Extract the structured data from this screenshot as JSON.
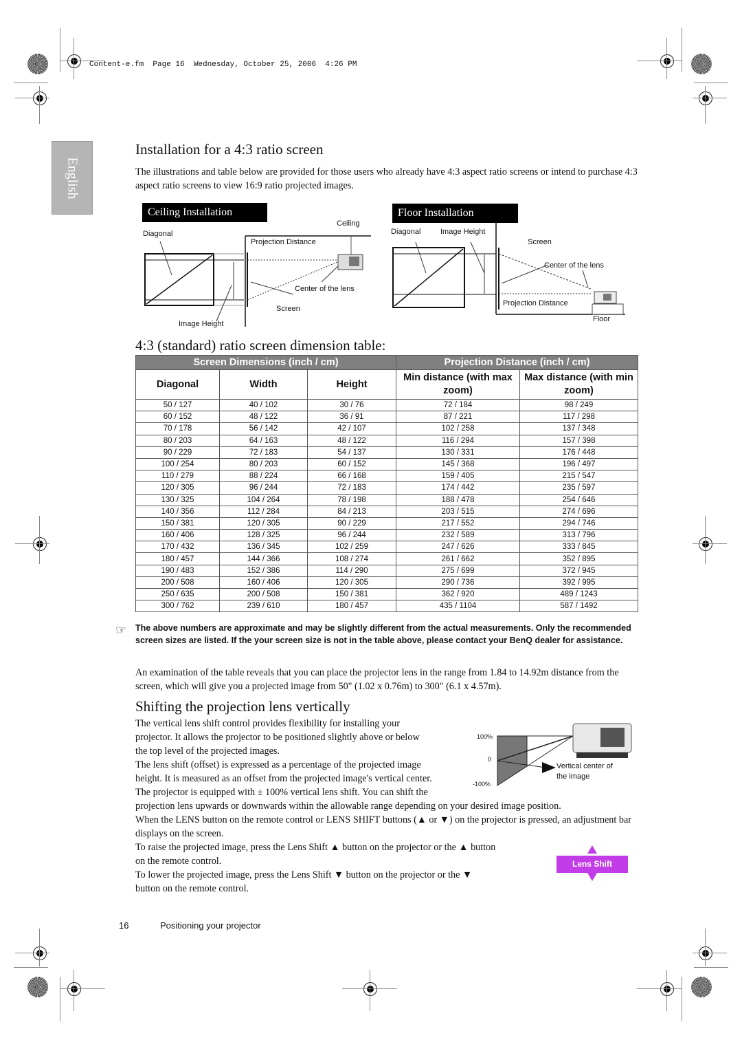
{
  "header": {
    "frame_info": "Content-e.fm  Page 16  Wednesday, October 25, 2006  4:26 PM"
  },
  "language_tab": "English",
  "section1": {
    "title": "Installation for a 4:3 ratio screen",
    "intro": "The illustrations and table below are provided for those users who already have 4:3 aspect ratio screens or intend to purchase 4:3 aspect ratio screens to view 16:9 ratio projected images."
  },
  "ceiling_diagram": {
    "label": "Ceiling Installation",
    "ceiling": "Ceiling",
    "diagonal": "Diagonal",
    "projection_distance": "Projection Distance",
    "center_of_lens": "Center of the lens",
    "screen": "Screen",
    "image_height": "Image Height"
  },
  "floor_diagram": {
    "label": "Floor Installation",
    "diagonal": "Diagonal",
    "image_height": "Image Height",
    "screen": "Screen",
    "center_of_lens": "Center of the lens",
    "projection_distance": "Projection Distance",
    "floor": "Floor"
  },
  "table_section": {
    "title": "4:3 (standard) ratio screen dimension table:",
    "group_headers": [
      "Screen Dimensions (inch / cm)",
      "Projection Distance (inch / cm)"
    ],
    "columns": [
      "Diagonal",
      "Width",
      "Height",
      "Min distance (with max zoom)",
      "Max distance (with min zoom)"
    ],
    "rows": [
      [
        "50 / 127",
        "40 / 102",
        "30 / 76",
        "72 / 184",
        "98 / 249"
      ],
      [
        "60 / 152",
        "48 / 122",
        "36 / 91",
        "87 / 221",
        "117 / 298"
      ],
      [
        "70 / 178",
        "56 / 142",
        "42 / 107",
        "102 / 258",
        "137 / 348"
      ],
      [
        "80 / 203",
        "64 / 163",
        "48 / 122",
        "116 / 294",
        "157 / 398"
      ],
      [
        "90 / 229",
        "72 / 183",
        "54 / 137",
        "130 / 331",
        "176 / 448"
      ],
      [
        "100 / 254",
        "80 / 203",
        "60 / 152",
        "145 / 368",
        "196 / 497"
      ],
      [
        "110 / 279",
        "88 / 224",
        "66 / 168",
        "159 / 405",
        "215 / 547"
      ],
      [
        "120 / 305",
        "96 / 244",
        "72 / 183",
        "174 / 442",
        "235 / 597"
      ],
      [
        "130 / 325",
        "104 / 264",
        "78 / 198",
        "188 / 478",
        "254 / 646"
      ],
      [
        "140 / 356",
        "112 / 284",
        "84 / 213",
        "203 / 515",
        "274 / 696"
      ],
      [
        "150 / 381",
        "120 / 305",
        "90 / 229",
        "217 / 552",
        "294 / 746"
      ],
      [
        "160 / 406",
        "128 / 325",
        "96 / 244",
        "232 / 589",
        "313 / 796"
      ],
      [
        "170 / 432",
        "136 / 345",
        "102 / 259",
        "247 / 626",
        "333 / 845"
      ],
      [
        "180 / 457",
        "144 / 366",
        "108 / 274",
        "261 / 662",
        "352 / 895"
      ],
      [
        "190 / 483",
        "152 / 386",
        "114 / 290",
        "275 / 699",
        "372 / 945"
      ],
      [
        "200 / 508",
        "160 / 406",
        "120 / 305",
        "290 / 736",
        "392 / 995"
      ],
      [
        "250 / 635",
        "200 / 508",
        "150 / 381",
        "362 / 920",
        "489 / 1243"
      ],
      [
        "300 / 762",
        "239 / 610",
        "180 / 457",
        "435 / 1104",
        "587 / 1492"
      ]
    ],
    "header_color": "#808080"
  },
  "note": "The above numbers are approximate and may be slightly different from the actual measurements. Only the recommended screen sizes are listed. If the your screen size is not in the table above, please contact your BenQ dealer for assistance.",
  "examination": "An examination of the table reveals that you can place the projector lens in the range from 1.84 to 14.92m distance from the screen, which will give you a projected image from 50\" (1.02 x 0.76m) to 300\" (6.1 x 4.57m).",
  "section2": {
    "title": "Shifting the projection lens vertically",
    "para1_lines": [
      "The vertical lens shift control provides flexibility for installing your",
      "projector. It allows the projector to be positioned slightly above or below",
      "the top level of the projected images.",
      "The lens shift (offset) is expressed as a percentage of the projected image",
      "height. It is measured as an offset from the projected image's vertical center.",
      "The projector is equipped with ± 100% vertical lens shift. You can shift the"
    ],
    "para1_cont": "projection lens upwards or downwards within the allowable range depending on your desired image position.",
    "para2": {
      "a": "When the ",
      "b": "LENS",
      "c": " button on the remote control or ",
      "d": "LENS SHIFT",
      "e": " buttons (▲ or ▼) on the projector is pressed, an adjustment bar displays on the screen."
    },
    "raise": {
      "a": "To raise the projected image, press the ",
      "b": "Lens Shift",
      "c": " ▲ button on the projector or the ▲ button",
      "d": "on the remote control."
    },
    "lower": {
      "a": "To lower the projected image, press the ",
      "b": "Lens Shift",
      "c": " ▼ button on the projector or the ▼",
      "d": "button on the remote control."
    },
    "shift_diagram": {
      "top": "100%",
      "center": "0",
      "bottom": "-100%",
      "caption_line1": "Vertical center of",
      "caption_line2": "the image"
    },
    "lens_shift_button": {
      "label": "Lens Shift",
      "color": "#c23de8"
    }
  },
  "footer": {
    "page_number": "16",
    "chapter": "Positioning your projector"
  }
}
